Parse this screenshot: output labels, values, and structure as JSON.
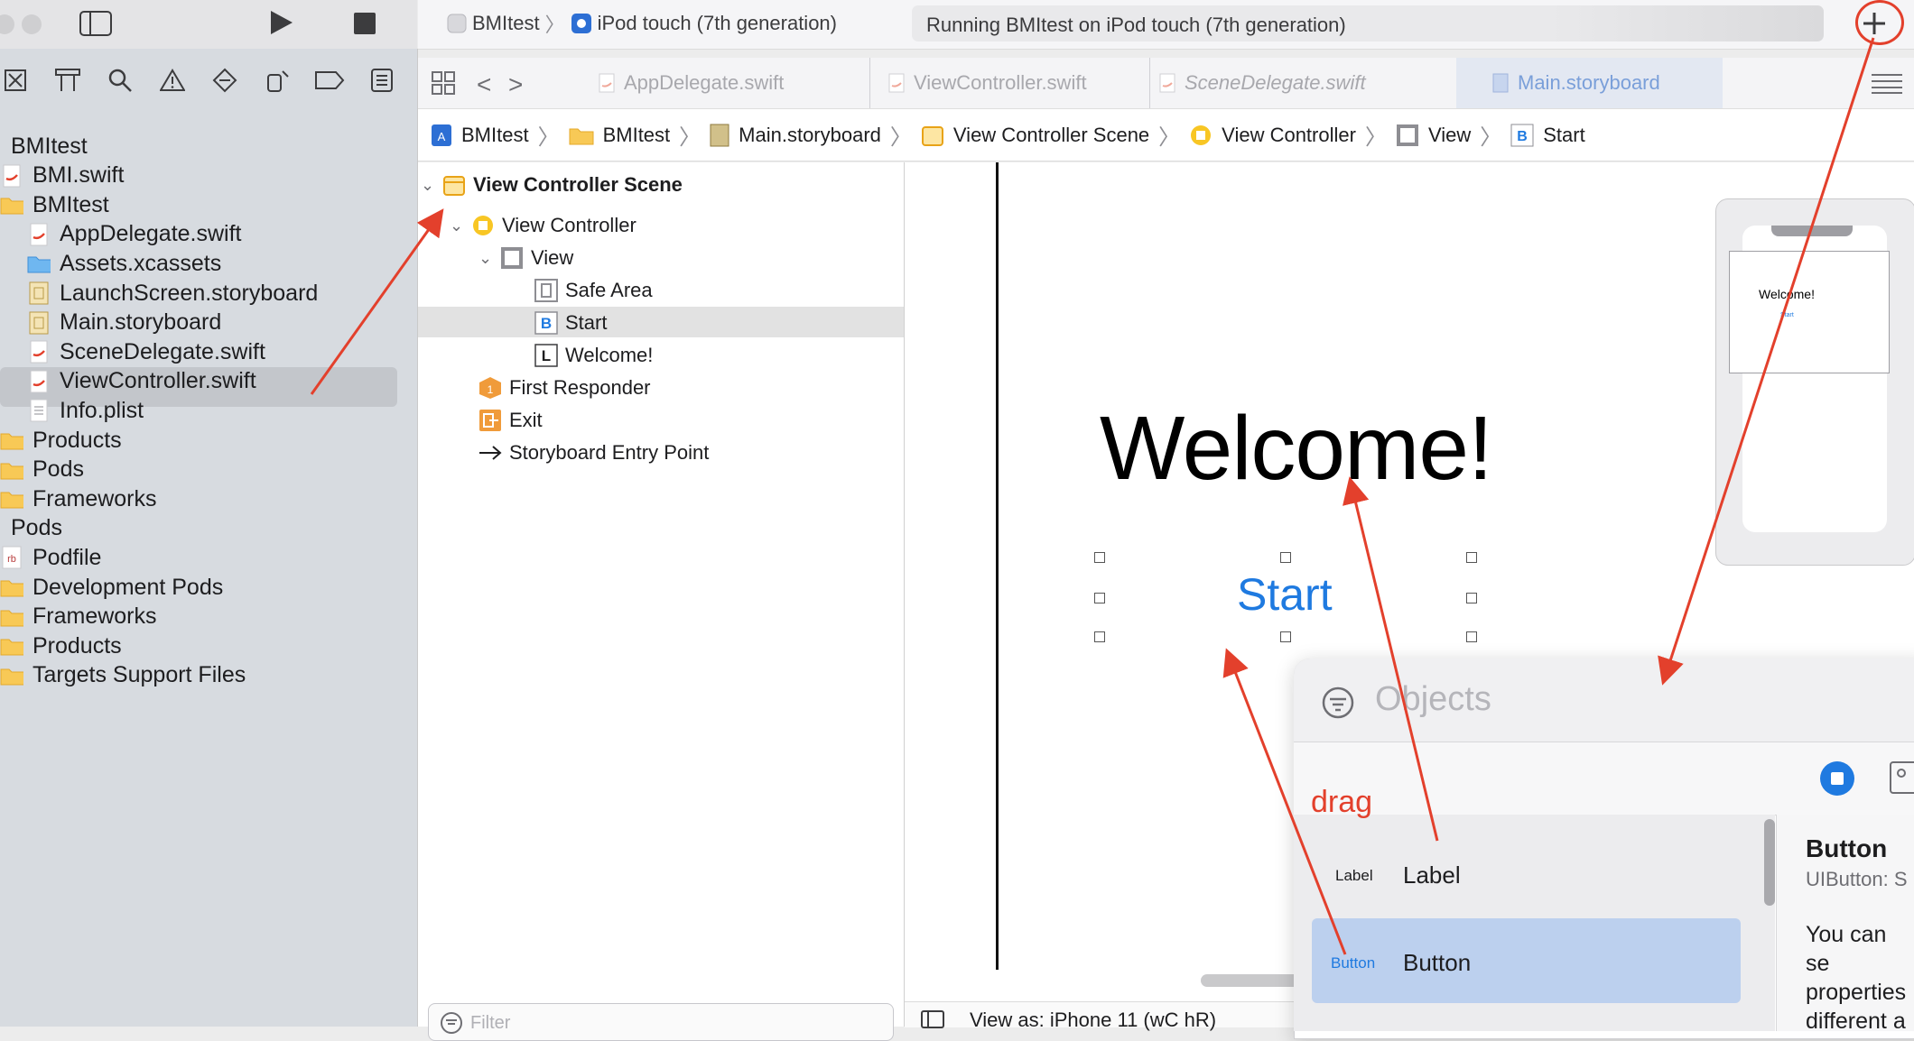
{
  "toolbar": {
    "scheme": "BMItest",
    "destination": "iPod touch (7th generation)",
    "status": "Running BMItest on iPod touch (7th generation)",
    "add_symbol": "+"
  },
  "navigator": {
    "items": [
      {
        "label": "BMItest",
        "icon": "project-icon"
      },
      {
        "label": "BMI.swift",
        "icon": "swift-file-icon"
      },
      {
        "label": "BMItest",
        "icon": "folder-icon"
      },
      {
        "label": "AppDelegate.swift",
        "icon": "swift-file-icon"
      },
      {
        "label": "Assets.xcassets",
        "icon": "assets-folder-icon"
      },
      {
        "label": "LaunchScreen.storyboard",
        "icon": "storyboard-file-icon"
      },
      {
        "label": "Main.storyboard",
        "icon": "storyboard-file-icon"
      },
      {
        "label": "SceneDelegate.swift",
        "icon": "swift-file-icon"
      },
      {
        "label": "ViewController.swift",
        "icon": "swift-file-icon"
      },
      {
        "label": "Info.plist",
        "icon": "plist-file-icon"
      },
      {
        "label": "Products",
        "icon": "folder-icon"
      },
      {
        "label": "Pods",
        "icon": "folder-icon"
      },
      {
        "label": "Frameworks",
        "icon": "folder-icon"
      },
      {
        "label": "Pods",
        "icon": "project-icon"
      },
      {
        "label": "Podfile",
        "icon": "ruby-file-icon"
      },
      {
        "label": "Development Pods",
        "icon": "folder-icon"
      },
      {
        "label": "Frameworks",
        "icon": "folder-icon"
      },
      {
        "label": "Products",
        "icon": "folder-icon"
      },
      {
        "label": "Targets Support Files",
        "icon": "folder-icon"
      }
    ]
  },
  "tabs": [
    {
      "label": "AppDelegate.swift"
    },
    {
      "label": "ViewController.swift"
    },
    {
      "label": "SceneDelegate.swift"
    },
    {
      "label": "Main.storyboard"
    }
  ],
  "breadcrumb": [
    "BMItest",
    "BMItest",
    "Main.storyboard",
    "View Controller Scene",
    "View Controller",
    "View",
    "Start"
  ],
  "outline": {
    "scene": "View Controller Scene",
    "view_controller": "View Controller",
    "view": "View",
    "safe_area": "Safe Area",
    "start": "Start",
    "welcome": "Welcome!",
    "first_responder": "First Responder",
    "exit": "Exit",
    "entry_point": "Storyboard Entry Point",
    "filter_placeholder": "Filter"
  },
  "canvas": {
    "welcome_text": "Welcome!",
    "start_text": "Start",
    "view_as": "View as: iPhone 11 (wC hR)",
    "minimap_welcome": "Welcome!",
    "minimap_start": "Start"
  },
  "library": {
    "search_placeholder": "Objects",
    "items": [
      {
        "thumb": "Label",
        "name": "Label"
      },
      {
        "thumb": "Button",
        "name": "Button"
      }
    ],
    "detail": {
      "title": "Button",
      "subtitle": "UIButton: S",
      "body": "You can se properties different a"
    }
  },
  "annotations": {
    "drag": "drag",
    "color": "#e3402c"
  },
  "colors": {
    "accent": "#1f7ae0",
    "selection": "#bcd0ee"
  }
}
